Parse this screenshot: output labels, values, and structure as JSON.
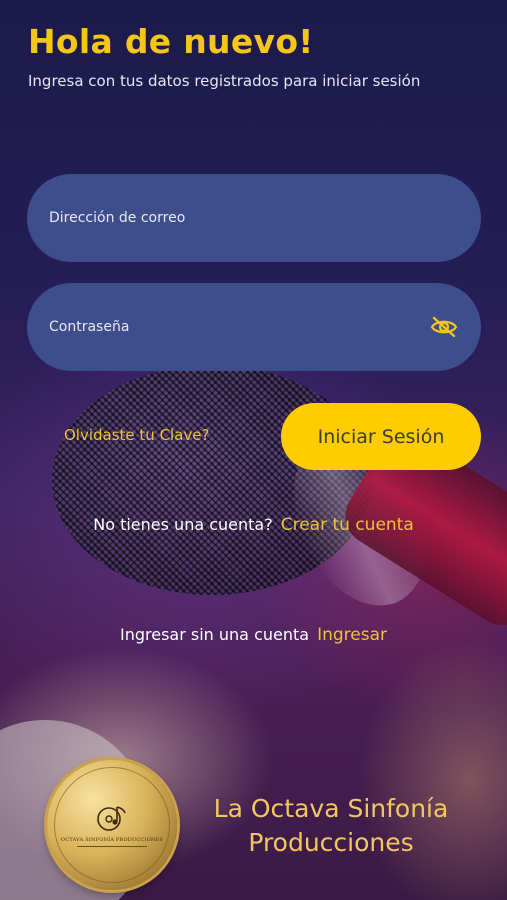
{
  "header": {
    "title": "Hola de nuevo!",
    "subtitle": "Ingresa con tus datos registrados para iniciar sesión"
  },
  "form": {
    "email_placeholder": "Dirección de correo",
    "email_value": "",
    "password_placeholder": "Contraseña",
    "password_value": "",
    "visibility_icon": "eye-off-icon",
    "forgot_label": "Olvidaste tu Clave?",
    "login_label": "Iniciar Sesión"
  },
  "signup": {
    "prompt": "No tienes una cuenta?",
    "link": "Crear tu cuenta"
  },
  "guest": {
    "prompt": "Ingresar sin una cuenta",
    "link": "Ingresar"
  },
  "brand": {
    "name": "La Octava Sinfonía Producciones",
    "logo_text": "OCTAVA SINFONÍA PRODUCCIONES"
  },
  "colors": {
    "accent": "#f5c518",
    "button": "#ffcc00",
    "field": "#3e4d8c",
    "link": "#f0c23a"
  }
}
